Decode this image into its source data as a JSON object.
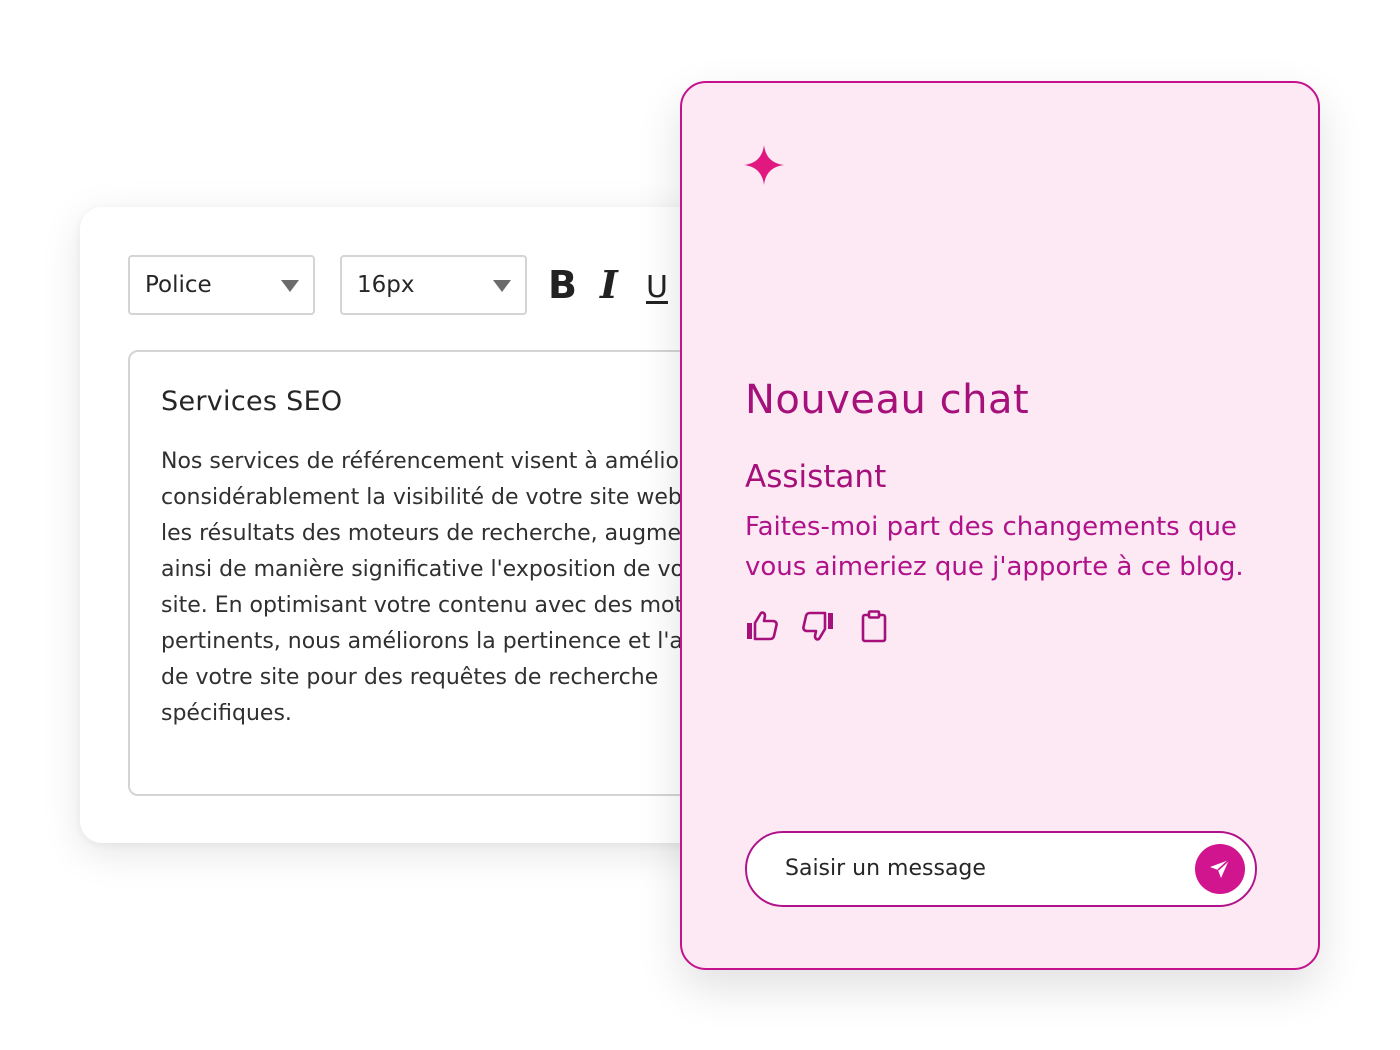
{
  "editor": {
    "font_select": {
      "value": "Police"
    },
    "size_select": {
      "value": "16px"
    },
    "format": {
      "bold": "B",
      "italic": "I",
      "underline": "U"
    },
    "document": {
      "title": "Services SEO",
      "body": "Nos services de référencement visent à améliorer considérablement la visibilité de votre site web dans les résultats des moteurs de recherche, augmentant ainsi de manière significative l'exposition de votre site. En optimisant votre contenu avec des mots clés pertinents, nous améliorons la pertinence et l'autorité de votre site pour des requêtes de recherche spécifiques."
    }
  },
  "chat": {
    "title": "Nouveau chat",
    "assistant_label": "Assistant",
    "assistant_message": "Faites-moi part des changements que vous aimeriez que j'apporte à ce blog.",
    "actions": [
      "thumbs-up-icon",
      "thumbs-down-icon",
      "clipboard-icon"
    ],
    "input": {
      "placeholder": "Saisir un message"
    },
    "colors": {
      "accent": "#c4128d",
      "panel_background": "#fce9f4",
      "text_accent": "#a5107a",
      "send_button": "#d1158f"
    }
  }
}
